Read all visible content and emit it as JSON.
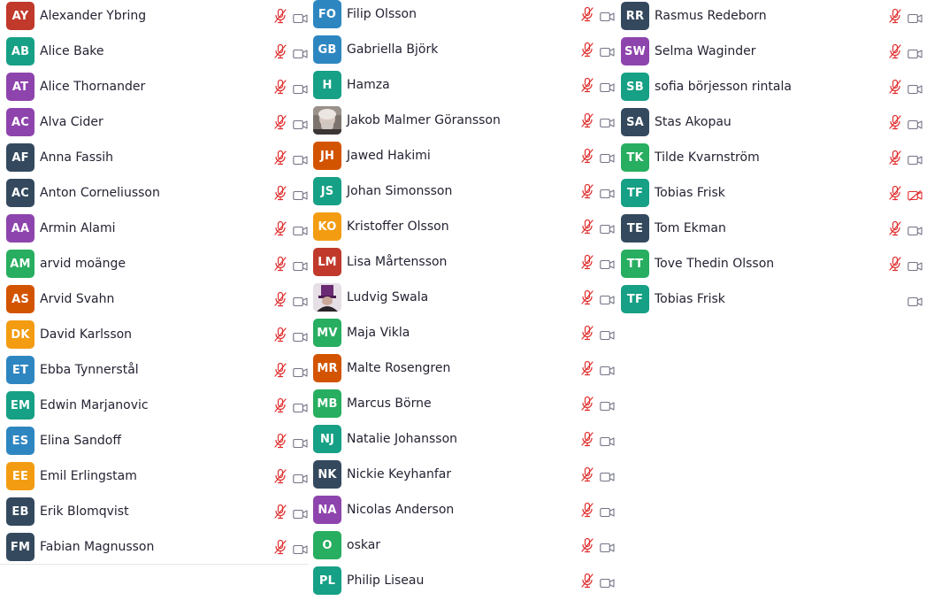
{
  "colors": {
    "red": "#c0392b",
    "teal": "#16a085",
    "purple": "#8e44ad",
    "navy": "#34495e",
    "orange": "#d35400",
    "yellow": "#f39c12",
    "blue": "#2e86c1",
    "green": "#27ae60",
    "mic_muted": "#e02f2f",
    "icon_gray": "#747487"
  },
  "columns": [
    {
      "participants": [
        {
          "initials": "AY",
          "name": "Alexander Ybring",
          "color": "#c0392b",
          "mic": "muted",
          "video": "on"
        },
        {
          "initials": "AB",
          "name": "Alice Bake",
          "color": "#16a085",
          "mic": "muted",
          "video": "on"
        },
        {
          "initials": "AT",
          "name": "Alice Thornander",
          "color": "#8e44ad",
          "mic": "muted",
          "video": "on"
        },
        {
          "initials": "AC",
          "name": "Alva Cider",
          "color": "#8e44ad",
          "mic": "muted",
          "video": "on"
        },
        {
          "initials": "AF",
          "name": "Anna Fassih",
          "color": "#34495e",
          "mic": "muted",
          "video": "on"
        },
        {
          "initials": "AC",
          "name": "Anton Corneliusson",
          "color": "#34495e",
          "mic": "muted",
          "video": "on"
        },
        {
          "initials": "AA",
          "name": "Armin Alami",
          "color": "#8e44ad",
          "mic": "muted",
          "video": "on"
        },
        {
          "initials": "AM",
          "name": "arvid moänge",
          "color": "#27ae60",
          "mic": "muted",
          "video": "on"
        },
        {
          "initials": "AS",
          "name": "Arvid Svahn",
          "color": "#d35400",
          "mic": "muted",
          "video": "on"
        },
        {
          "initials": "DK",
          "name": "David Karlsson",
          "color": "#f39c12",
          "mic": "muted",
          "video": "on"
        },
        {
          "initials": "ET",
          "name": "Ebba Tynnerstål",
          "color": "#2e86c1",
          "mic": "muted",
          "video": "on"
        },
        {
          "initials": "EM",
          "name": "Edwin Marjanovic",
          "color": "#16a085",
          "mic": "muted",
          "video": "on"
        },
        {
          "initials": "ES",
          "name": "Elina Sandoff",
          "color": "#2e86c1",
          "mic": "muted",
          "video": "on"
        },
        {
          "initials": "EE",
          "name": "Emil Erlingstam",
          "color": "#f39c12",
          "mic": "muted",
          "video": "on"
        },
        {
          "initials": "EB",
          "name": "Erik Blomqvist",
          "color": "#34495e",
          "mic": "muted",
          "video": "on"
        },
        {
          "initials": "FM",
          "name": "Fabian Magnusson",
          "color": "#34495e",
          "mic": "muted",
          "video": "on"
        }
      ]
    },
    {
      "participants": [
        {
          "initials": "FO",
          "name": "Filip Olsson",
          "color": "#2e86c1",
          "mic": "muted",
          "video": "on"
        },
        {
          "initials": "GB",
          "name": "Gabriella Björk",
          "color": "#2e86c1",
          "mic": "muted",
          "video": "on"
        },
        {
          "initials": "H",
          "name": "Hamza",
          "color": "#16a085",
          "mic": "muted",
          "video": "on"
        },
        {
          "initials": "",
          "name": "Jakob Malmer Göransson",
          "color": "#8a8280",
          "photo": "portrait-man",
          "mic": "muted",
          "video": "on"
        },
        {
          "initials": "JH",
          "name": "Jawed Hakimi",
          "color": "#d35400",
          "mic": "muted",
          "video": "on"
        },
        {
          "initials": "JS",
          "name": "Johan Simonsson",
          "color": "#16a085",
          "mic": "muted",
          "video": "on"
        },
        {
          "initials": "KO",
          "name": "Kristoffer Olsson",
          "color": "#f39c12",
          "mic": "muted",
          "video": "on"
        },
        {
          "initials": "LM",
          "name": "Lisa Mårtensson",
          "color": "#c0392b",
          "mic": "muted",
          "video": "on"
        },
        {
          "initials": "",
          "name": "Ludvig Swala",
          "color": "#d8d0d8",
          "photo": "portrait-hat",
          "mic": "muted",
          "video": "on"
        },
        {
          "initials": "MV",
          "name": "Maja Vikla",
          "color": "#27ae60",
          "mic": "muted",
          "video": "on"
        },
        {
          "initials": "MR",
          "name": "Malte Rosengren",
          "color": "#d35400",
          "mic": "muted",
          "video": "on"
        },
        {
          "initials": "MB",
          "name": "Marcus Börne",
          "color": "#27ae60",
          "mic": "muted",
          "video": "on"
        },
        {
          "initials": "NJ",
          "name": "Natalie Johansson",
          "color": "#16a085",
          "mic": "muted",
          "video": "on"
        },
        {
          "initials": "NK",
          "name": "Nickie Keyhanfar",
          "color": "#34495e",
          "mic": "muted",
          "video": "on"
        },
        {
          "initials": "NA",
          "name": "Nicolas Anderson",
          "color": "#8e44ad",
          "mic": "muted",
          "video": "on"
        },
        {
          "initials": "O",
          "name": "oskar",
          "color": "#27ae60",
          "mic": "muted",
          "video": "on"
        },
        {
          "initials": "PL",
          "name": "Philip Liseau",
          "color": "#16a085",
          "mic": "muted",
          "video": "on"
        }
      ]
    },
    {
      "participants": [
        {
          "initials": "RR",
          "name": "Rasmus Redeborn",
          "color": "#34495e",
          "mic": "muted",
          "video": "on"
        },
        {
          "initials": "SW",
          "name": "Selma Waginder",
          "color": "#8e44ad",
          "mic": "muted",
          "video": "on"
        },
        {
          "initials": "SB",
          "name": "sofia börjesson rintala",
          "color": "#16a085",
          "mic": "muted",
          "video": "on"
        },
        {
          "initials": "SA",
          "name": "Stas Akopau",
          "color": "#34495e",
          "mic": "muted",
          "video": "on"
        },
        {
          "initials": "TK",
          "name": "Tilde Kvarnström",
          "color": "#27ae60",
          "mic": "muted",
          "video": "on"
        },
        {
          "initials": "TF",
          "name": "Tobias Frisk",
          "color": "#16a085",
          "mic": "muted",
          "video": "off"
        },
        {
          "initials": "TE",
          "name": "Tom Ekman",
          "color": "#34495e",
          "mic": "muted",
          "video": "on"
        },
        {
          "initials": "TT",
          "name": "Tove Thedin Olsson",
          "color": "#27ae60",
          "mic": "muted",
          "video": "on"
        },
        {
          "initials": "TF",
          "name": "Tobias Frisk",
          "color": "#16a085",
          "mic": "none",
          "video": "on"
        }
      ]
    }
  ]
}
